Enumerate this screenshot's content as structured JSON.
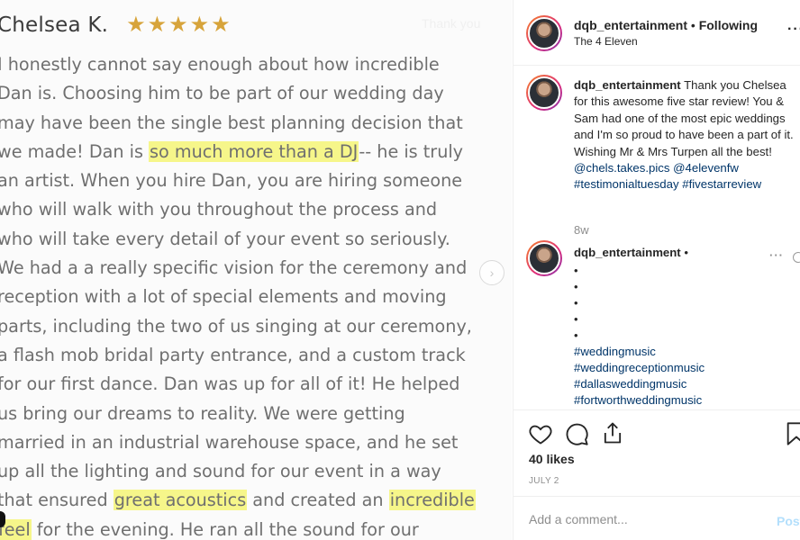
{
  "review": {
    "reviewer_name": "Chelsea K.",
    "rating_stars": 5,
    "faded_text": "Thank you",
    "lines": [
      {
        "parts": [
          {
            "t": "I honestly cannot say enough about how incredible",
            "hl": false
          }
        ]
      },
      {
        "parts": [
          {
            "t": "Dan is. Choosing him to be part of our wedding day",
            "hl": false
          }
        ]
      },
      {
        "parts": [
          {
            "t": "may have been the single best planning decision that",
            "hl": false
          }
        ]
      },
      {
        "parts": [
          {
            "t": "we made! Dan is ",
            "hl": false
          },
          {
            "t": "so much more than a DJ",
            "hl": true
          },
          {
            "t": "-- he is truly",
            "hl": false
          }
        ]
      },
      {
        "parts": [
          {
            "t": "an artist. When you hire Dan, you are hiring someone",
            "hl": false
          }
        ]
      },
      {
        "parts": [
          {
            "t": "who will walk with you throughout the process and",
            "hl": false
          }
        ]
      },
      {
        "parts": [
          {
            "t": "who will take every detail of your event so seriously.",
            "hl": false
          }
        ]
      },
      {
        "parts": [
          {
            "t": "We had a a really specific vision for the ceremony and",
            "hl": false
          }
        ]
      },
      {
        "parts": [
          {
            "t": "reception with a lot of special elements and moving",
            "hl": false
          }
        ]
      },
      {
        "parts": [
          {
            "t": "parts, including the two of us singing at our ceremony,",
            "hl": false
          }
        ]
      },
      {
        "parts": [
          {
            "t": "a flash mob bridal party entrance, and a custom track",
            "hl": false
          }
        ]
      },
      {
        "parts": [
          {
            "t": "for our first dance. Dan was up for all of it! He helped",
            "hl": false
          }
        ]
      },
      {
        "parts": [
          {
            "t": "us bring our dreams to reality. We were getting",
            "hl": false
          }
        ]
      },
      {
        "parts": [
          {
            "t": "married in an industrial warehouse space, and he set",
            "hl": false
          }
        ]
      },
      {
        "parts": [
          {
            "t": "up all the lighting and sound for our event in a way",
            "hl": false
          }
        ]
      },
      {
        "parts": [
          {
            "t": "that ensured ",
            "hl": false
          },
          {
            "t": "great acoustics",
            "hl": true
          },
          {
            "t": " and created an ",
            "hl": false
          },
          {
            "t": "incredible",
            "hl": true
          }
        ]
      },
      {
        "parts": [
          {
            "t": "feel",
            "hl": true,
            "u": true
          },
          {
            "t": " for the evening. He ran all the sound for our",
            "hl": false
          }
        ]
      }
    ],
    "next_arrow_icon": "chevron-right-icon"
  },
  "post": {
    "username": "dqb_entertainment",
    "separator": " • ",
    "follow_status": "Following",
    "location": "The 4 Eleven",
    "caption": {
      "username": "dqb_entertainment",
      "text": " Thank you Chelsea for this awesome five star review! You & Sam had one of the most epic weddings and I'm so proud to have been a part of it. Wishing Mr & Mrs Turpen all the best! ",
      "mention": "@chels.takes.pics",
      "mention2": "@4elevenfw",
      "tag1": " #testimonialtuesday",
      "tag2": "#fivestarreview",
      "time": "8w"
    },
    "comment": {
      "username": "dqb_entertainment",
      "suffix": " •",
      "bullets": [
        "•",
        "•",
        "•",
        "•",
        "•"
      ],
      "tags": [
        "#weddingmusic",
        "#weddingreceptionmusic",
        "#dallasweddingmusic",
        "#fortworthweddingmusic"
      ]
    },
    "likes": "40 likes",
    "date": "JULY 2",
    "comment_placeholder": "Add a comment...",
    "post_button": "Post"
  },
  "colors": {
    "highlight": "#f6f68a",
    "star": "#d7a43b",
    "link": "#003569"
  }
}
